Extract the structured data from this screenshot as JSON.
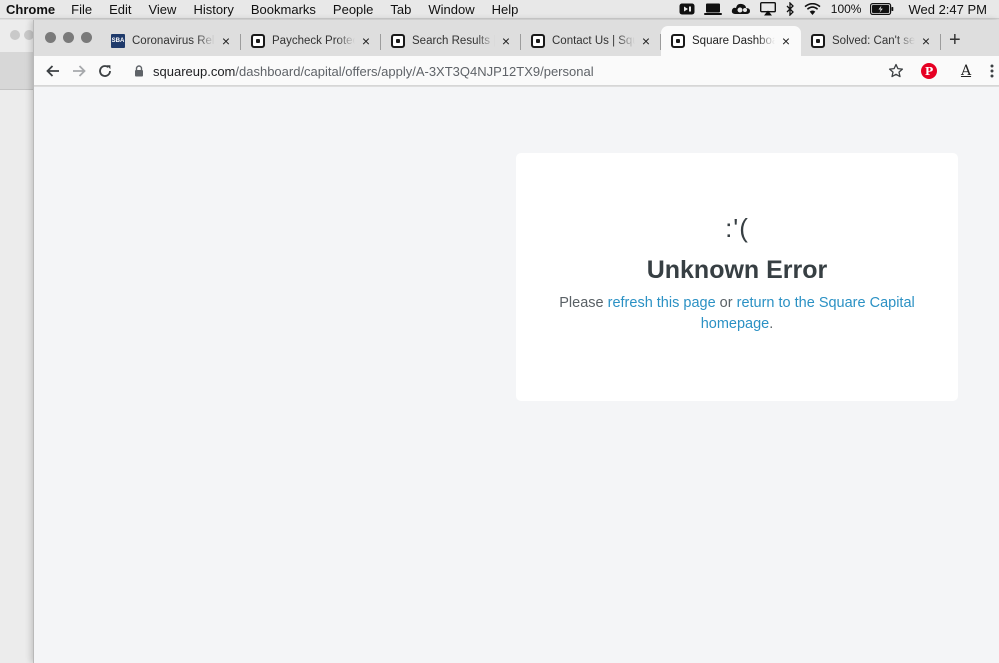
{
  "menubar": {
    "app": "Chrome",
    "items": [
      "File",
      "Edit",
      "View",
      "History",
      "Bookmarks",
      "People",
      "Tab",
      "Window",
      "Help"
    ],
    "battery": "100%",
    "clock": "Wed 2:47 PM",
    "status_icons": [
      "facetime-icon",
      "display-icon",
      "creative-cloud-icon",
      "airplay-icon",
      "bluetooth-icon",
      "wifi-icon",
      "battery-icon"
    ]
  },
  "tabs": [
    {
      "title": "Coronavirus Relief Options",
      "favicon": "sba-icon",
      "active": false
    },
    {
      "title": "Paycheck Protection Program",
      "favicon": "square-icon",
      "active": false
    },
    {
      "title": "Search Results | Square",
      "favicon": "square-icon",
      "active": false
    },
    {
      "title": "Contact Us | Square",
      "favicon": "square-icon",
      "active": false
    },
    {
      "title": "Square Dashboard",
      "favicon": "square-icon",
      "active": true
    },
    {
      "title": "Solved: Can't select",
      "favicon": "square-icon",
      "active": false
    }
  ],
  "sba_favicon_text": "SBA",
  "new_tab_label": "+",
  "close_glyph": "×",
  "address": {
    "host": "squareup.com",
    "path": "/dashboard/capital/offers/apply/A-3XT3Q4NJP12TX9/personal"
  },
  "extensions": {
    "pinterest_glyph": "P",
    "font_glyph": "A"
  },
  "error": {
    "face": ":'(",
    "title": "Unknown Error",
    "prefix": "Please",
    "link_refresh": "refresh this page",
    "middle": "or",
    "link_home": "return to the Square Capital homepage",
    "suffix": "."
  },
  "colors": {
    "link": "#2b91c4",
    "title": "#373f43",
    "page_bg": "#f4f5f7",
    "pinterest": "#e60023"
  }
}
